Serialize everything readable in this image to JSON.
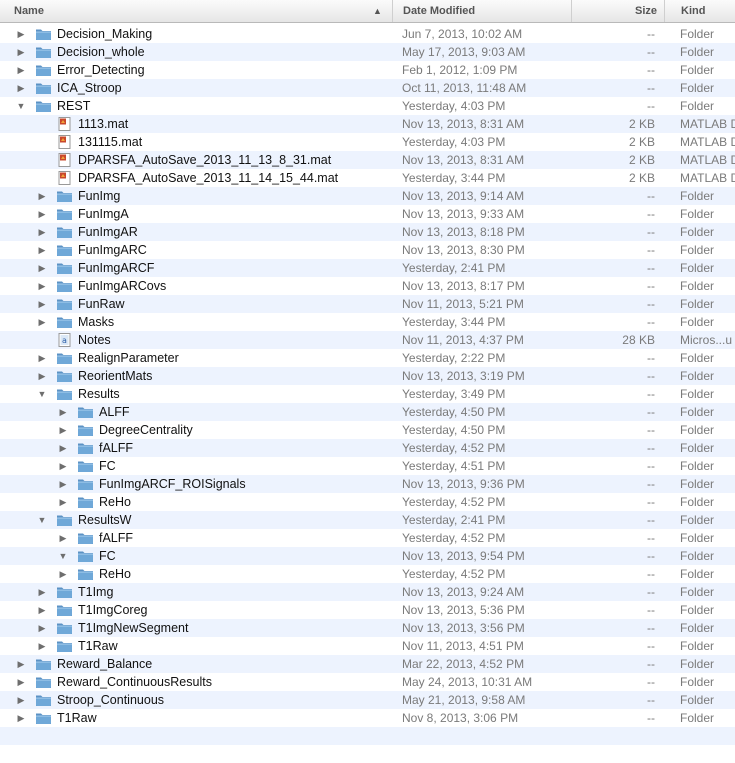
{
  "header": {
    "name": "Name",
    "date_modified": "Date Modified",
    "size": "Size",
    "kind": "Kind",
    "sort_indicator": "▲"
  },
  "rows": [
    {
      "name": "Decision_Making",
      "date": "Jun 7, 2013, 10:02 AM",
      "size": "--",
      "kind": "Folder",
      "depth": 0,
      "type": "folder",
      "state": "closed",
      "icon": "folder-icon"
    },
    {
      "name": "Decision_whole",
      "date": "May 17, 2013, 9:03 AM",
      "size": "--",
      "kind": "Folder",
      "depth": 0,
      "type": "folder",
      "state": "closed",
      "icon": "folder-icon"
    },
    {
      "name": "Error_Detecting",
      "date": "Feb 1, 2012, 1:09 PM",
      "size": "--",
      "kind": "Folder",
      "depth": 0,
      "type": "folder",
      "state": "closed",
      "icon": "folder-icon"
    },
    {
      "name": "ICA_Stroop",
      "date": "Oct 11, 2013, 11:48 AM",
      "size": "--",
      "kind": "Folder",
      "depth": 0,
      "type": "folder",
      "state": "closed",
      "icon": "folder-icon"
    },
    {
      "name": "REST",
      "date": "Yesterday, 4:03 PM",
      "size": "--",
      "kind": "Folder",
      "depth": 0,
      "type": "folder",
      "state": "open",
      "icon": "folder-icon"
    },
    {
      "name": "1113.mat",
      "date": "Nov 13, 2013, 8:31 AM",
      "size": "2 KB",
      "kind": "MATLAB D",
      "depth": 1,
      "type": "file",
      "state": "none",
      "icon": "matlab-file-icon"
    },
    {
      "name": "131115.mat",
      "date": "Yesterday, 4:03 PM",
      "size": "2 KB",
      "kind": "MATLAB D",
      "depth": 1,
      "type": "file",
      "state": "none",
      "icon": "matlab-file-icon"
    },
    {
      "name": "DPARSFA_AutoSave_2013_11_13_8_31.mat",
      "date": "Nov 13, 2013, 8:31 AM",
      "size": "2 KB",
      "kind": "MATLAB D",
      "depth": 1,
      "type": "file",
      "state": "none",
      "icon": "matlab-file-icon"
    },
    {
      "name": "DPARSFA_AutoSave_2013_11_14_15_44.mat",
      "date": "Yesterday, 3:44 PM",
      "size": "2 KB",
      "kind": "MATLAB D",
      "depth": 1,
      "type": "file",
      "state": "none",
      "icon": "matlab-file-icon"
    },
    {
      "name": "FunImg",
      "date": "Nov 13, 2013, 9:14 AM",
      "size": "--",
      "kind": "Folder",
      "depth": 1,
      "type": "folder",
      "state": "closed",
      "icon": "folder-icon"
    },
    {
      "name": "FunImgA",
      "date": "Nov 13, 2013, 9:33 AM",
      "size": "--",
      "kind": "Folder",
      "depth": 1,
      "type": "folder",
      "state": "closed",
      "icon": "folder-icon"
    },
    {
      "name": "FunImgAR",
      "date": "Nov 13, 2013, 8:18 PM",
      "size": "--",
      "kind": "Folder",
      "depth": 1,
      "type": "folder",
      "state": "closed",
      "icon": "folder-icon"
    },
    {
      "name": "FunImgARC",
      "date": "Nov 13, 2013, 8:30 PM",
      "size": "--",
      "kind": "Folder",
      "depth": 1,
      "type": "folder",
      "state": "closed",
      "icon": "folder-icon"
    },
    {
      "name": "FunImgARCF",
      "date": "Yesterday, 2:41 PM",
      "size": "--",
      "kind": "Folder",
      "depth": 1,
      "type": "folder",
      "state": "closed",
      "icon": "folder-icon"
    },
    {
      "name": "FunImgARCovs",
      "date": "Nov 13, 2013, 8:17 PM",
      "size": "--",
      "kind": "Folder",
      "depth": 1,
      "type": "folder",
      "state": "closed",
      "icon": "folder-icon"
    },
    {
      "name": "FunRaw",
      "date": "Nov 11, 2013, 5:21 PM",
      "size": "--",
      "kind": "Folder",
      "depth": 1,
      "type": "folder",
      "state": "closed",
      "icon": "folder-icon"
    },
    {
      "name": "Masks",
      "date": "Yesterday, 3:44 PM",
      "size": "--",
      "kind": "Folder",
      "depth": 1,
      "type": "folder",
      "state": "closed",
      "icon": "folder-icon"
    },
    {
      "name": "Notes",
      "date": "Nov 11, 2013, 4:37 PM",
      "size": "28 KB",
      "kind": "Micros...u",
      "depth": 1,
      "type": "file",
      "state": "none",
      "icon": "text-document-icon"
    },
    {
      "name": "RealignParameter",
      "date": "Yesterday, 2:22 PM",
      "size": "--",
      "kind": "Folder",
      "depth": 1,
      "type": "folder",
      "state": "closed",
      "icon": "folder-icon"
    },
    {
      "name": "ReorientMats",
      "date": "Nov 13, 2013, 3:19 PM",
      "size": "--",
      "kind": "Folder",
      "depth": 1,
      "type": "folder",
      "state": "closed",
      "icon": "folder-icon"
    },
    {
      "name": "Results",
      "date": "Yesterday, 3:49 PM",
      "size": "--",
      "kind": "Folder",
      "depth": 1,
      "type": "folder",
      "state": "open",
      "icon": "folder-icon"
    },
    {
      "name": "ALFF",
      "date": "Yesterday, 4:50 PM",
      "size": "--",
      "kind": "Folder",
      "depth": 2,
      "type": "folder",
      "state": "closed",
      "icon": "folder-icon"
    },
    {
      "name": "DegreeCentrality",
      "date": "Yesterday, 4:50 PM",
      "size": "--",
      "kind": "Folder",
      "depth": 2,
      "type": "folder",
      "state": "closed",
      "icon": "folder-icon"
    },
    {
      "name": "fALFF",
      "date": "Yesterday, 4:52 PM",
      "size": "--",
      "kind": "Folder",
      "depth": 2,
      "type": "folder",
      "state": "closed",
      "icon": "folder-icon"
    },
    {
      "name": "FC",
      "date": "Yesterday, 4:51 PM",
      "size": "--",
      "kind": "Folder",
      "depth": 2,
      "type": "folder",
      "state": "closed",
      "icon": "folder-icon"
    },
    {
      "name": "FunImgARCF_ROISignals",
      "date": "Nov 13, 2013, 9:36 PM",
      "size": "--",
      "kind": "Folder",
      "depth": 2,
      "type": "folder",
      "state": "closed",
      "icon": "folder-icon"
    },
    {
      "name": "ReHo",
      "date": "Yesterday, 4:52 PM",
      "size": "--",
      "kind": "Folder",
      "depth": 2,
      "type": "folder",
      "state": "closed",
      "icon": "folder-icon"
    },
    {
      "name": "ResultsW",
      "date": "Yesterday, 2:41 PM",
      "size": "--",
      "kind": "Folder",
      "depth": 1,
      "type": "folder",
      "state": "open",
      "icon": "folder-icon"
    },
    {
      "name": "fALFF",
      "date": "Yesterday, 4:52 PM",
      "size": "--",
      "kind": "Folder",
      "depth": 2,
      "type": "folder",
      "state": "closed",
      "icon": "folder-icon"
    },
    {
      "name": "FC",
      "date": "Nov 13, 2013, 9:54 PM",
      "size": "--",
      "kind": "Folder",
      "depth": 2,
      "type": "folder",
      "state": "open",
      "icon": "folder-icon"
    },
    {
      "name": "ReHo",
      "date": "Yesterday, 4:52 PM",
      "size": "--",
      "kind": "Folder",
      "depth": 2,
      "type": "folder",
      "state": "closed",
      "icon": "folder-icon"
    },
    {
      "name": "T1Img",
      "date": "Nov 13, 2013, 9:24 AM",
      "size": "--",
      "kind": "Folder",
      "depth": 1,
      "type": "folder",
      "state": "closed",
      "icon": "folder-icon"
    },
    {
      "name": "T1ImgCoreg",
      "date": "Nov 13, 2013, 5:36 PM",
      "size": "--",
      "kind": "Folder",
      "depth": 1,
      "type": "folder",
      "state": "closed",
      "icon": "folder-icon"
    },
    {
      "name": "T1ImgNewSegment",
      "date": "Nov 13, 2013, 3:56 PM",
      "size": "--",
      "kind": "Folder",
      "depth": 1,
      "type": "folder",
      "state": "closed",
      "icon": "folder-icon"
    },
    {
      "name": "T1Raw",
      "date": "Nov 11, 2013, 4:51 PM",
      "size": "--",
      "kind": "Folder",
      "depth": 1,
      "type": "folder",
      "state": "closed",
      "icon": "folder-icon"
    },
    {
      "name": "Reward_Balance",
      "date": "Mar 22, 2013, 4:52 PM",
      "size": "--",
      "kind": "Folder",
      "depth": 0,
      "type": "folder",
      "state": "closed",
      "icon": "folder-icon"
    },
    {
      "name": "Reward_ContinuousResults",
      "date": "May 24, 2013, 10:31 AM",
      "size": "--",
      "kind": "Folder",
      "depth": 0,
      "type": "folder",
      "state": "closed",
      "icon": "folder-icon"
    },
    {
      "name": "Stroop_Continuous",
      "date": "May 21, 2013, 9:58 AM",
      "size": "--",
      "kind": "Folder",
      "depth": 0,
      "type": "folder",
      "state": "closed",
      "icon": "folder-icon"
    },
    {
      "name": "T1Raw",
      "date": "Nov 8, 2013, 3:06 PM",
      "size": "--",
      "kind": "Folder",
      "depth": 0,
      "type": "folder",
      "state": "closed",
      "icon": "folder-icon"
    }
  ],
  "colors": {
    "row_alt": "#edf3fe",
    "folder_body": "#6fa8d8",
    "folder_tab": "#5b92c4",
    "text_secondary": "#7a7a7a"
  }
}
